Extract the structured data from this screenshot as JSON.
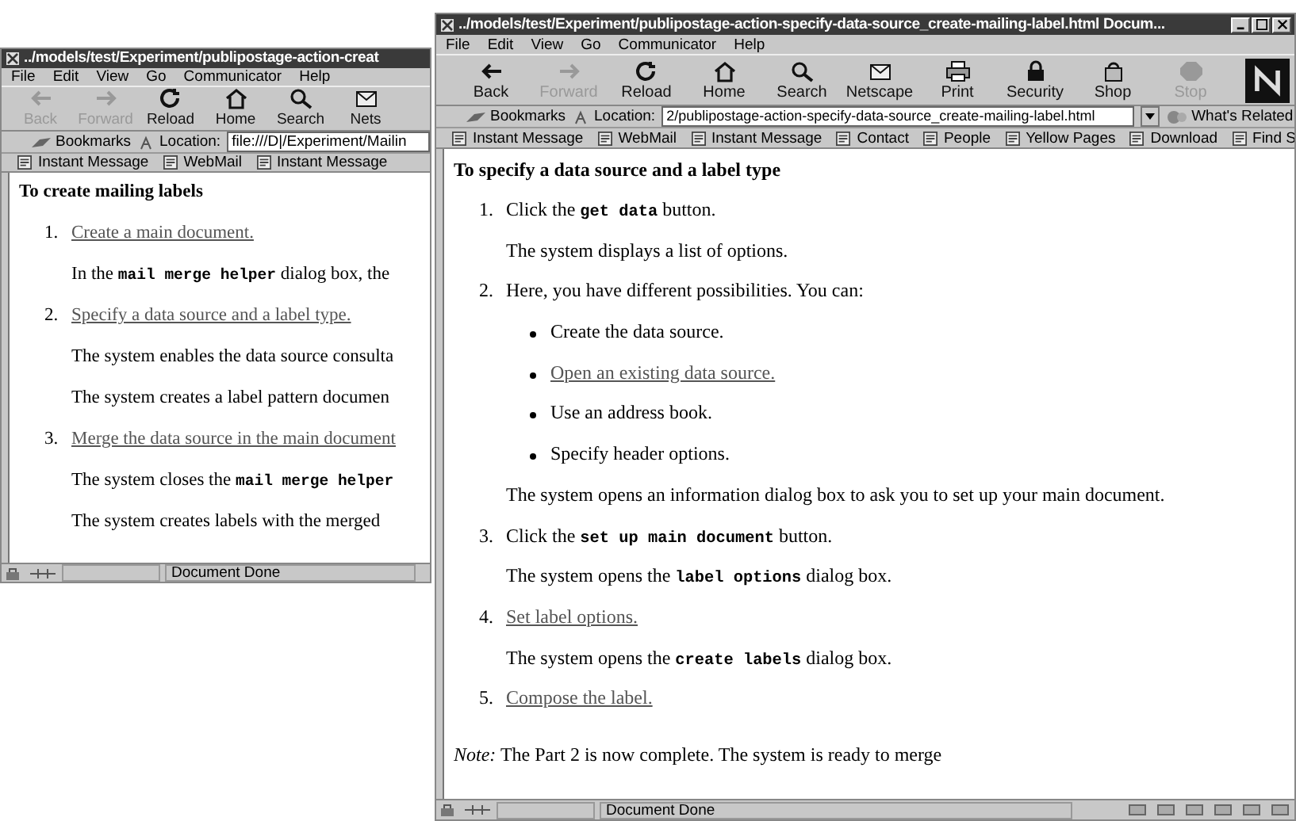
{
  "windows": [
    {
      "title": "../models/test/Experiment/publipostage-action-creat",
      "menu": [
        "File",
        "Edit",
        "View",
        "Go",
        "Communicator",
        "Help"
      ],
      "toolbar": [
        {
          "label": "Back",
          "disabled": true
        },
        {
          "label": "Forward",
          "disabled": true
        },
        {
          "label": "Reload",
          "disabled": false
        },
        {
          "label": "Home",
          "disabled": false
        },
        {
          "label": "Search",
          "disabled": false
        },
        {
          "label": "Nets",
          "disabled": false
        }
      ],
      "bookmarks": "Bookmarks",
      "location_label": "Location:",
      "location": "file:///D|/Experiment/Mailin",
      "personal_toolbar": [
        "Instant Message",
        "WebMail",
        "Instant Message"
      ],
      "heading": "To create mailing labels",
      "items": [
        {
          "kind": "step",
          "number": "1.",
          "text": "Create a main document.",
          "link": true
        },
        {
          "kind": "para",
          "segments": [
            {
              "text": "In the ",
              "kind": "text"
            },
            {
              "text": "mail merge helper",
              "kind": "code"
            },
            {
              "text": " dialog box, the",
              "kind": "text"
            }
          ]
        },
        {
          "kind": "step",
          "number": "2.",
          "text": "Specify a data source and a label type.",
          "link": true
        },
        {
          "kind": "para",
          "segments": [
            {
              "text": "The system enables the data source consulta",
              "kind": "text"
            }
          ]
        },
        {
          "kind": "para",
          "segments": [
            {
              "text": "The system creates a label pattern documen",
              "kind": "text"
            }
          ]
        },
        {
          "kind": "step",
          "number": "3.",
          "text": "Merge the data source in the main document",
          "link": true
        },
        {
          "kind": "para",
          "segments": [
            {
              "text": "The system closes the ",
              "kind": "text"
            },
            {
              "text": "mail merge helper",
              "kind": "code"
            }
          ]
        },
        {
          "kind": "para",
          "segments": [
            {
              "text": "The system creates labels with the merged",
              "kind": "text"
            }
          ]
        }
      ],
      "status": "Document Done"
    },
    {
      "title": "../models/test/Experiment/publipostage-action-specify-data-source_create-mailing-label.html Docum...",
      "menu": [
        "File",
        "Edit",
        "View",
        "Go",
        "Communicator",
        "Help"
      ],
      "toolbar": [
        {
          "label": "Back",
          "disabled": false
        },
        {
          "label": "Forward",
          "disabled": true
        },
        {
          "label": "Reload",
          "disabled": false
        },
        {
          "label": "Home",
          "disabled": false
        },
        {
          "label": "Search",
          "disabled": false
        },
        {
          "label": "Netscape",
          "disabled": false
        },
        {
          "label": "Print",
          "disabled": false
        },
        {
          "label": "Security",
          "disabled": false
        },
        {
          "label": "Shop",
          "disabled": false
        },
        {
          "label": "Stop",
          "disabled": true
        }
      ],
      "bookmarks": "Bookmarks",
      "location_label": "Location:",
      "location": "2/publipostage-action-specify-data-source_create-mailing-label.html",
      "related": "What's Related",
      "personal_toolbar": [
        "Instant Message",
        "WebMail",
        "Instant Message",
        "Contact",
        "People",
        "Yellow Pages",
        "Download",
        "Find S"
      ],
      "heading": "To specify a data source and a label type",
      "items": [
        {
          "kind": "step",
          "number": "1.",
          "segments": [
            {
              "text": "Click the ",
              "kind": "text"
            },
            {
              "text": "get data",
              "kind": "code"
            },
            {
              "text": " button.",
              "kind": "text"
            }
          ],
          "link": false
        },
        {
          "kind": "para",
          "segments": [
            {
              "text": "The system displays a list of options.",
              "kind": "text"
            }
          ]
        },
        {
          "kind": "step",
          "number": "2.",
          "text": "Here, you have different possibilities. You can:",
          "link": false
        },
        {
          "kind": "bullet",
          "text": "Create the data source.",
          "link": false
        },
        {
          "kind": "bullet",
          "text": "Open an existing data source.",
          "link": true
        },
        {
          "kind": "bullet",
          "text": "Use an address book.",
          "link": false
        },
        {
          "kind": "bullet",
          "text": "Specify header options.",
          "link": false
        },
        {
          "kind": "para",
          "segments": [
            {
              "text": "The system opens an information dialog box to ask you to set up your main document.",
              "kind": "text"
            }
          ]
        },
        {
          "kind": "step",
          "number": "3.",
          "segments": [
            {
              "text": "Click the ",
              "kind": "text"
            },
            {
              "text": "set up main document",
              "kind": "code"
            },
            {
              "text": " button.",
              "kind": "text"
            }
          ],
          "link": false
        },
        {
          "kind": "para",
          "segments": [
            {
              "text": "The system opens the ",
              "kind": "text"
            },
            {
              "text": "label options",
              "kind": "code"
            },
            {
              "text": " dialog box.",
              "kind": "text"
            }
          ]
        },
        {
          "kind": "step",
          "number": "4.",
          "text": "Set label options.",
          "link": true
        },
        {
          "kind": "para",
          "segments": [
            {
              "text": "The system opens the ",
              "kind": "text"
            },
            {
              "text": "create labels",
              "kind": "code"
            },
            {
              "text": " dialog box.",
              "kind": "text"
            }
          ]
        },
        {
          "kind": "step",
          "number": "5.",
          "text": "Compose the label.",
          "link": true
        },
        {
          "kind": "note",
          "text": "*Note:* The Part 2 is now complete. The system is ready to merge"
        }
      ],
      "status": "Document Done"
    }
  ]
}
